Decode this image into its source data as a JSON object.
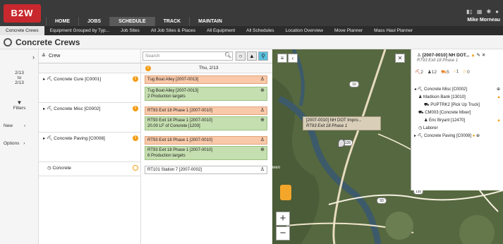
{
  "app": {
    "logo_text": "B2W",
    "nav": [
      "HOME",
      "JOBS",
      "SCHEDULE",
      "TRACK",
      "MAINTAIN"
    ],
    "active_nav": "SCHEDULE",
    "user_name": "Mike Morneau",
    "icon_names": [
      "bar-chart-icon",
      "calendar-icon",
      "gear-icon",
      "help-icon"
    ]
  },
  "subnav": [
    "Concrete Crews",
    "Equipment Grouped by Typ...",
    "Job Sites",
    "All Job Sites & Places",
    "All Equipment",
    "All Schedules",
    "Location Overview",
    "Move Planner",
    "Mass Haul Planner"
  ],
  "page": {
    "title": "Concrete Crews"
  },
  "sidebar": {
    "date_range": [
      "2/13",
      "to",
      "2/13"
    ],
    "filters_label": "Filters",
    "new_label": "New",
    "options_label": "Options"
  },
  "crew_column": {
    "header": "Crew",
    "search_placeholder": "Search",
    "rows": [
      {
        "name": "Concrete Cure [C0001]"
      },
      {
        "name": "Concrete Misc [C0002]"
      },
      {
        "name": "Concrete Paving [C0008]"
      },
      {
        "name": "Concrete"
      }
    ]
  },
  "calendar": {
    "date_header": "Thu, 2/13",
    "cards": [
      {
        "text": "Tug Boat Alley [2007-0013]",
        "color": "orange"
      },
      {
        "text": "Tug Boat Alley [2007-0013]",
        "line2": "2 Production targets",
        "color": "green"
      },
      {
        "text": "RT93 Exit 18 Phase 1 [2007-0010]",
        "color": "orange"
      },
      {
        "text": "RT93 Exit 18 Phase 1 [2007-0010]",
        "line2": "20.00 LF of Concrete [1200]",
        "color": "green"
      },
      {
        "text": "RT93 Exit 18 Phase 1 [2007-0010]",
        "color": "orange"
      },
      {
        "text": "RT93 Exit 18 Phase 1 [2007-0010]",
        "line2": "6 Production targets",
        "color": "green"
      },
      {
        "text": "RT101 Station 7 [2007-0002]",
        "color": "white"
      }
    ]
  },
  "map": {
    "tooltip_title": "[2007-0010] NH DOT Impro...",
    "tooltip_sub": "RT93 Exit 18 Phase 1",
    "road_labels": [
      "10",
      "93",
      "135",
      "302",
      "135"
    ],
    "town_label": "wen"
  },
  "panel": {
    "title": "[2007-0010] NH DOT...",
    "subtitle": "RT93 Exit 18 Phase 1",
    "stats": [
      "2",
      "12",
      "5",
      "1",
      "0"
    ],
    "tree": [
      "Concrete Misc [C0002]",
      "Madison Bank [13010]",
      "PUPTRK2 [Pick Up Truck]",
      "CM003 [Concrete Mixer]",
      "Eric Bryant [12470]",
      "Laborer",
      "Concrete Paving [C0008]"
    ]
  }
}
